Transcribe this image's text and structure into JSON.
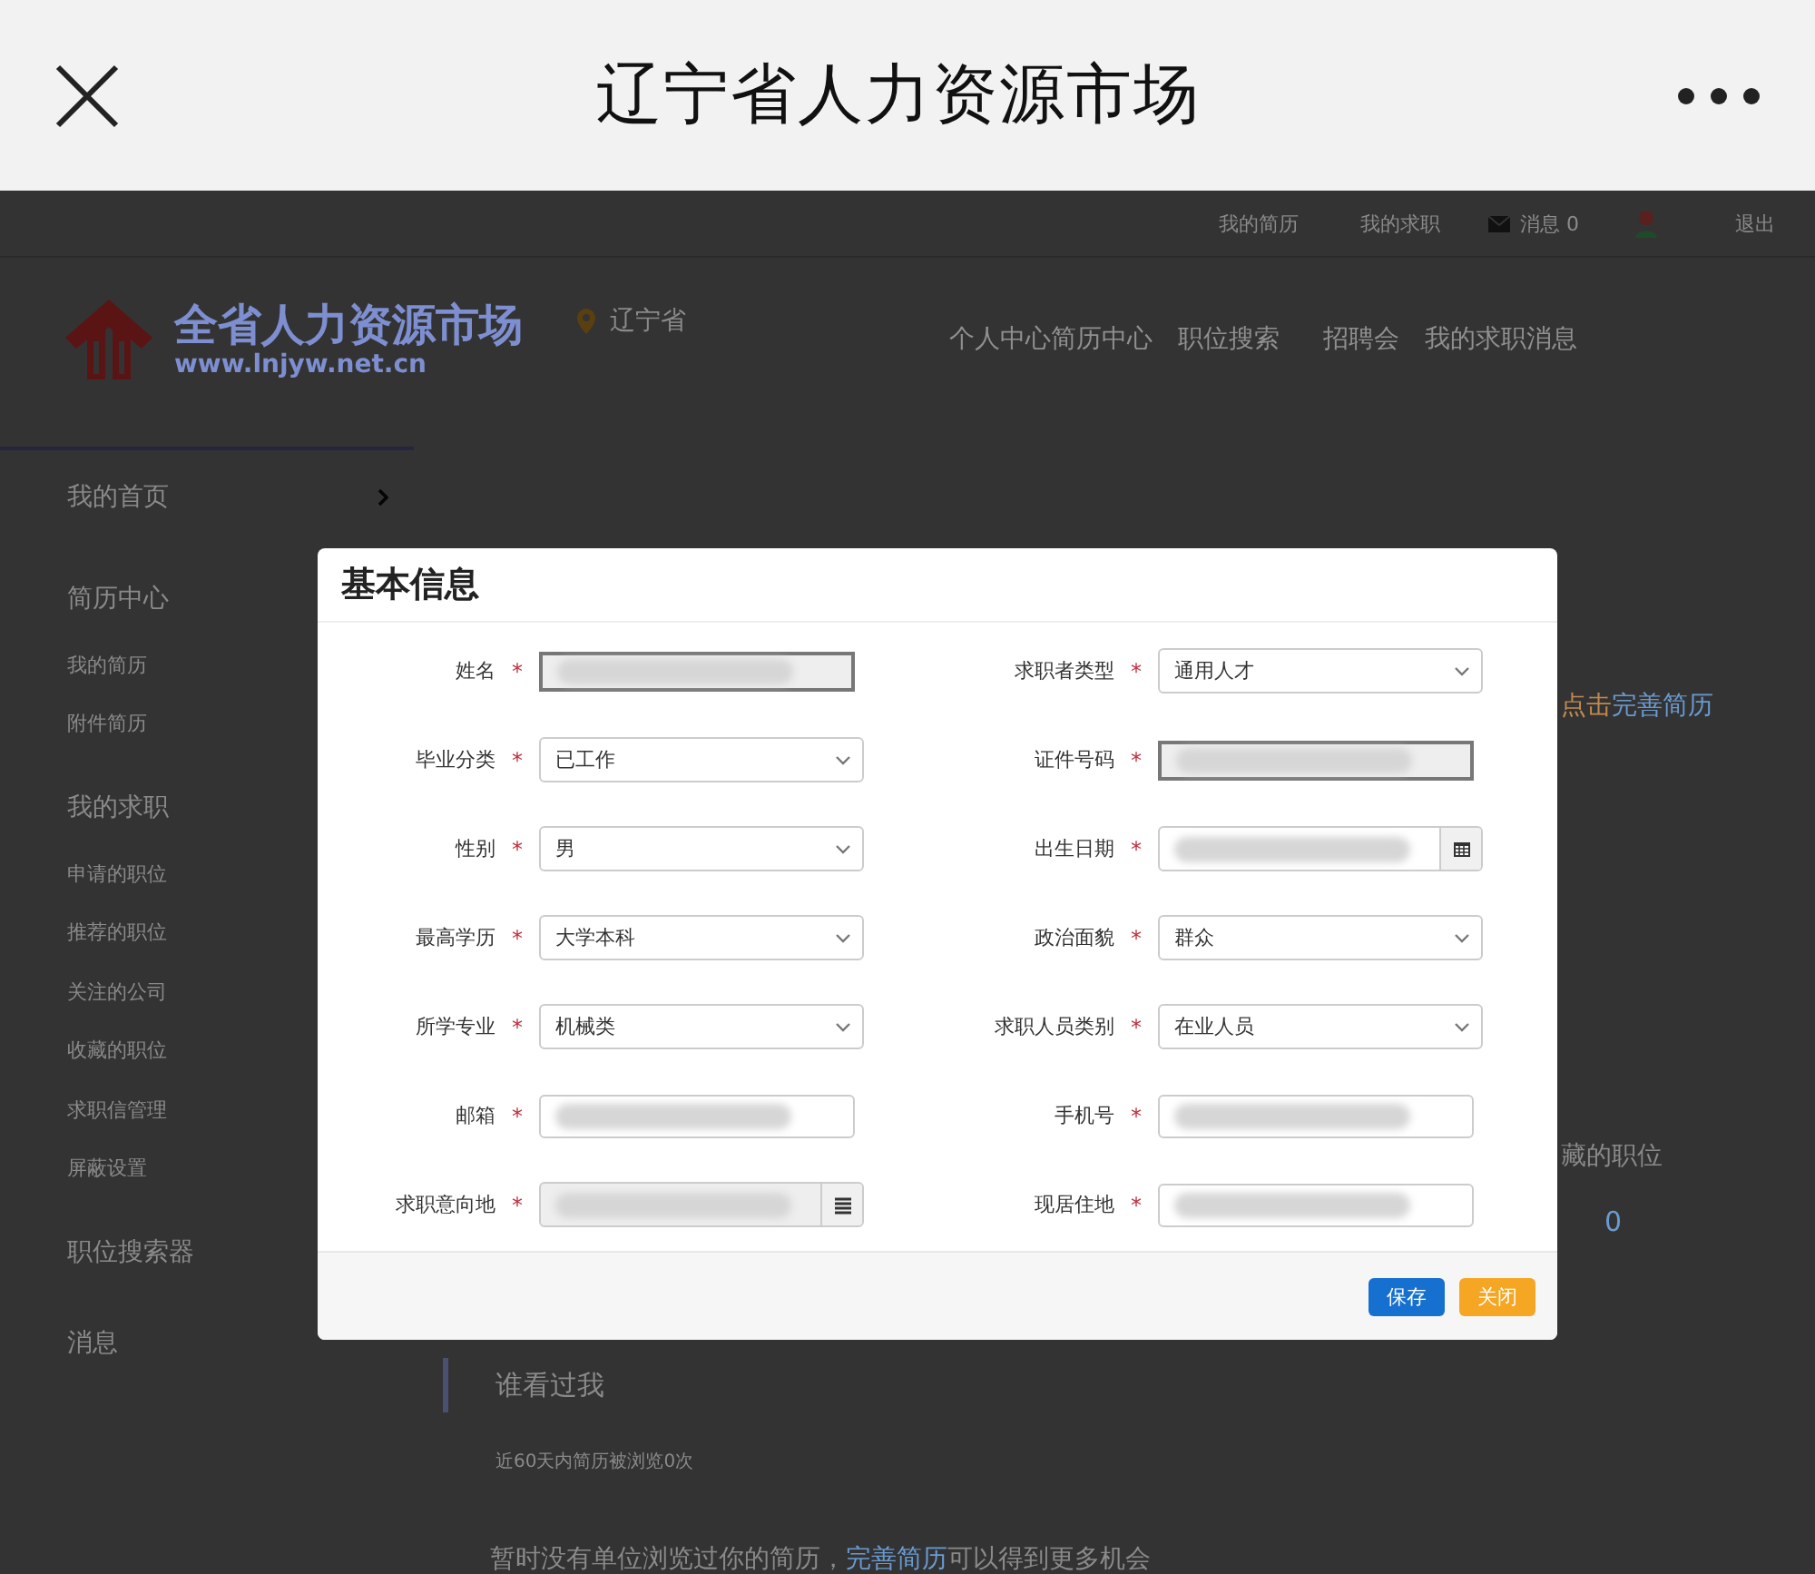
{
  "app_bar": {
    "title": "辽宁省人力资源市场"
  },
  "top_links": {
    "items": [
      "我的简历",
      "我的求职"
    ],
    "messages_label": "消息",
    "messages_count": "0",
    "logout": "退出"
  },
  "header": {
    "logo_title": "全省人力资源市场",
    "logo_url": "www.lnjyw.net.cn",
    "location": "辽宁省",
    "nav": [
      "个人中心",
      "简历中心",
      "职位搜索",
      "招聘会",
      "我的求职消息"
    ]
  },
  "sidebar": {
    "items": [
      {
        "label": "我的首页",
        "kind": "home"
      },
      {
        "label": "简历中心",
        "kind": "section"
      },
      {
        "label": "我的简历",
        "kind": "link"
      },
      {
        "label": "附件简历",
        "kind": "link"
      },
      {
        "label": "我的求职",
        "kind": "section"
      },
      {
        "label": "申请的职位",
        "kind": "link"
      },
      {
        "label": "推荐的职位",
        "kind": "link"
      },
      {
        "label": "关注的公司",
        "kind": "link"
      },
      {
        "label": "收藏的职位",
        "kind": "link"
      },
      {
        "label": "求职信管理",
        "kind": "link"
      },
      {
        "label": "屏蔽设置",
        "kind": "link"
      },
      {
        "label": "职位搜索器",
        "kind": "section"
      },
      {
        "label": "消息",
        "kind": "section"
      }
    ]
  },
  "main": {
    "complete_prompt": "点击",
    "complete_link": "完善简历",
    "saved_jobs_label": "藏的职位",
    "saved_jobs_count": "0",
    "viewers_title": "谁看过我",
    "viewers_stat": "近60天内简历被浏览0次",
    "viewers_empty": "暂时没有单位浏览过你的简历，",
    "viewers_link": "完善简历",
    "viewers_tail": "可以得到更多机会"
  },
  "dialog": {
    "title": "基本信息",
    "fields": [
      {
        "label": "姓名",
        "marker": "*",
        "kind": "readonly",
        "redacted": true
      },
      {
        "label": "求职者类型",
        "marker": "*",
        "kind": "select",
        "value": "通用人才"
      },
      {
        "label": "毕业分类",
        "marker": "*",
        "kind": "select",
        "value": "已工作"
      },
      {
        "label": "证件号码",
        "marker": "*",
        "kind": "readonly",
        "redacted": true
      },
      {
        "label": "性别",
        "marker": "*",
        "kind": "select",
        "value": "男"
      },
      {
        "label": "出生日期",
        "marker": "*",
        "kind": "date",
        "redacted": true
      },
      {
        "label": "最高学历",
        "marker": "*",
        "kind": "select",
        "value": "大学本科"
      },
      {
        "label": "政治面貌",
        "marker": "*",
        "kind": "select",
        "value": "群众"
      },
      {
        "label": "所学专业",
        "marker": "*",
        "kind": "select",
        "value": "机械类"
      },
      {
        "label": "求职人员类别",
        "marker": "*",
        "kind": "select",
        "value": "在业人员"
      },
      {
        "label": "邮箱",
        "marker": "*",
        "kind": "text",
        "redacted": true
      },
      {
        "label": "手机号",
        "marker": "*",
        "kind": "text",
        "redacted": true
      },
      {
        "label": "求职意向地",
        "marker": "*",
        "kind": "picker",
        "redacted": true
      },
      {
        "label": "现居住地",
        "marker": "*",
        "kind": "text",
        "redacted": true
      }
    ],
    "buttons": [
      {
        "label": "保存",
        "kind": "primary"
      },
      {
        "label": "关闭",
        "kind": "warning"
      }
    ]
  }
}
